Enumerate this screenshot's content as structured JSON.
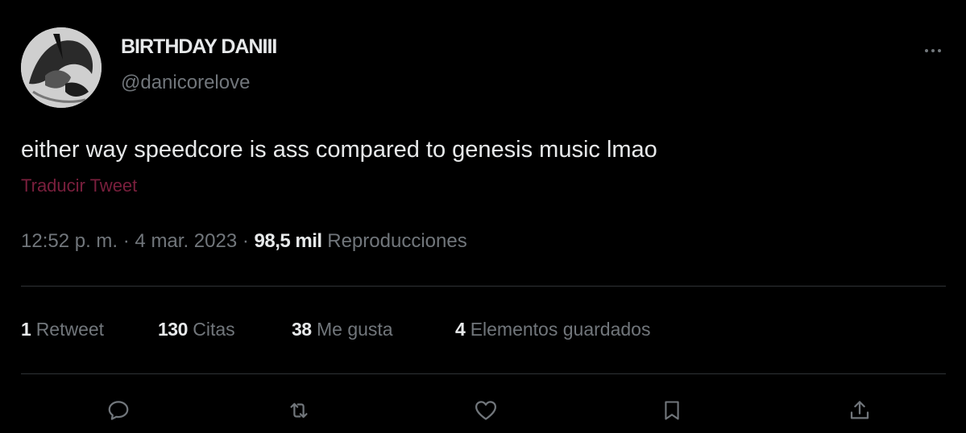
{
  "tweet": {
    "display_name": "BIRTHDAY DANIII",
    "handle": "@danicorelove",
    "text": "either way speedcore is ass compared to genesis music lmao",
    "translate_label": "Traducir Tweet",
    "time": "12:52 p. m.",
    "separator": "·",
    "date": "4 mar. 2023",
    "views_count": "98,5 mil",
    "views_label": "Reproducciones"
  },
  "stats": [
    {
      "count": "1",
      "label": "Retweet"
    },
    {
      "count": "130",
      "label": "Citas"
    },
    {
      "count": "38",
      "label": "Me gusta"
    },
    {
      "count": "4",
      "label": "Elementos guardados"
    }
  ],
  "icons": {
    "more": "more-horizontal-icon",
    "reply": "reply-icon",
    "retweet": "retweet-icon",
    "like": "like-icon",
    "bookmark": "bookmark-icon",
    "share": "share-icon"
  },
  "colors": {
    "background": "#000000",
    "text_primary": "#e7e9ea",
    "text_secondary": "#71767b",
    "translate_link": "#7a1f3d",
    "divider": "#2f3336"
  }
}
